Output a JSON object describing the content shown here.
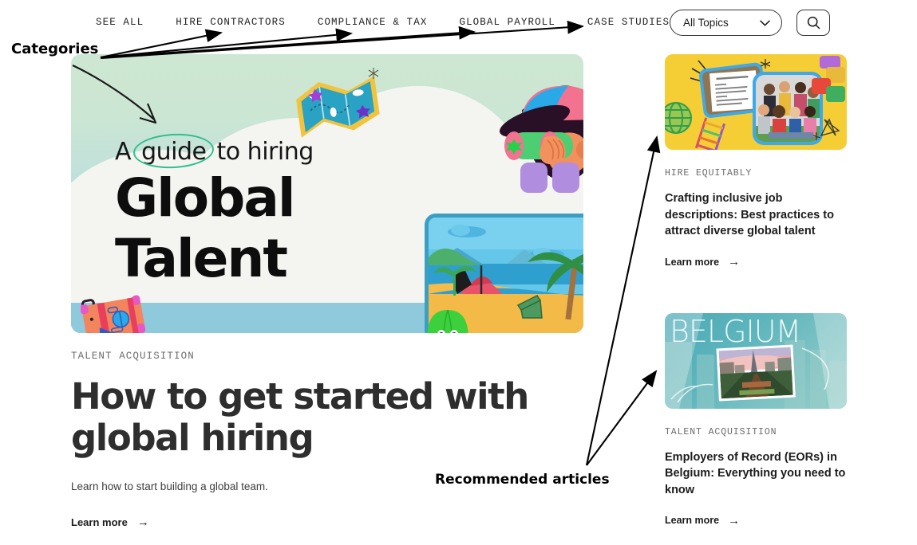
{
  "nav": {
    "links": [
      {
        "label": "SEE ALL"
      },
      {
        "label": "HIRE CONTRACTORS"
      },
      {
        "label": "COMPLIANCE & TAX"
      },
      {
        "label": "GLOBAL PAYROLL"
      },
      {
        "label": "CASE STUDIES"
      }
    ],
    "topic_filter": {
      "selected": "All Topics",
      "options": [
        "All Topics"
      ],
      "chevron_icon": "chevron-down-icon"
    },
    "search": {
      "icon": "search-icon"
    }
  },
  "hero": {
    "image": {
      "kicker_a": "A",
      "kicker_circled": "guide",
      "kicker_b": "to hiring",
      "big_line_1": "Global",
      "big_line_2": "Talent",
      "illustrations": [
        "map-icon",
        "person-binoculars-icon",
        "hot-air-balloon-icon",
        "suitcase-icon",
        "beach-scene-icon",
        "satellite-signal-icon"
      ]
    },
    "category": "TALENT ACQUISITION",
    "headline": "How to get started with global hiring",
    "description": "Learn how to start building a global team.",
    "learn_more": "Learn more",
    "arrow_icon": "arrow-right-icon"
  },
  "sidebar": {
    "cards": [
      {
        "category": "HIRE EQUITABLY",
        "title": "Crafting inclusive job descriptions: Best practices to attract diverse global talent",
        "learn_more": "Learn more",
        "image_alt": "job-description-collage",
        "bg_color": "#f5ce36"
      },
      {
        "category": "TALENT ACQUISITION",
        "title": "Employers of Record (EORs) in Belgium: Everything you need to know",
        "learn_more": "Learn more",
        "image_alt": "belgium-cityscape",
        "image_word": "BELGIUM",
        "bg_color": "#5fb6bd"
      }
    ]
  },
  "annotations": [
    {
      "id": "categories",
      "label": "Categories",
      "arrow_count": 4
    },
    {
      "id": "recommended",
      "label": "Recommended articles",
      "arrow_count": 2
    }
  ],
  "colors": {
    "accent_green": "#2fbf8f",
    "text_dark": "#1c1c1c",
    "text_muted": "#6b6b6b",
    "annotation": "#000000"
  }
}
